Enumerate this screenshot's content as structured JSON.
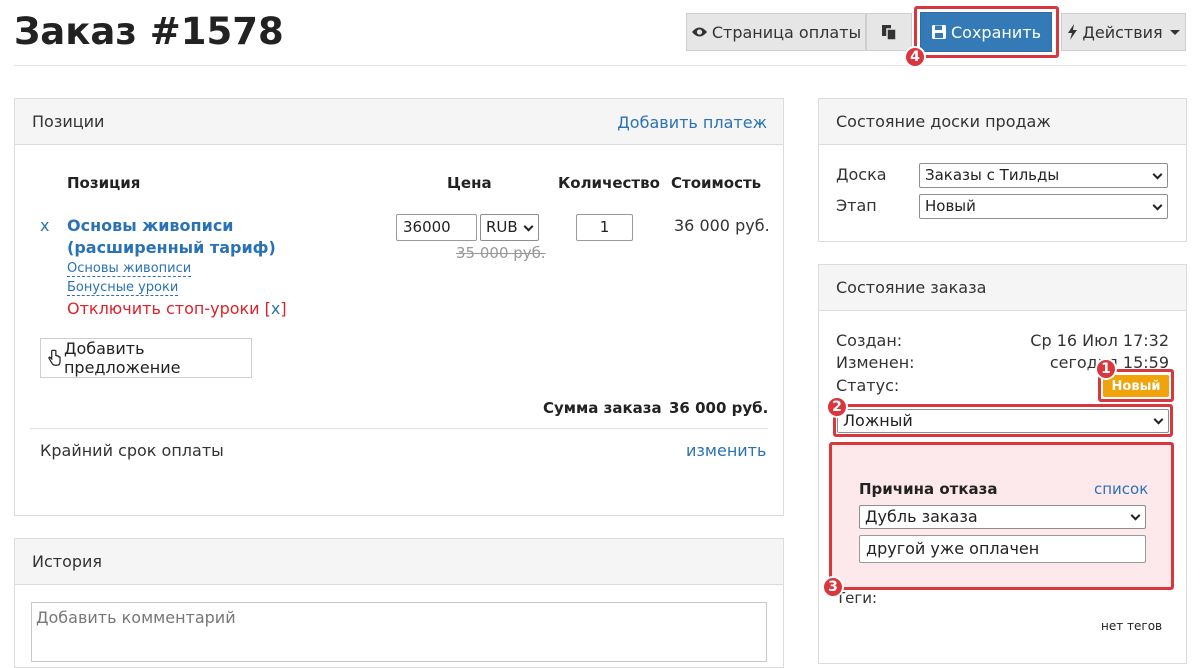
{
  "header": {
    "title": "Заказ #1578",
    "payment_page_label": "Страница оплаты",
    "save_label": "Сохранить",
    "actions_label": "Действия"
  },
  "positions": {
    "title": "Позиции",
    "add_payment": "Добавить платеж",
    "columns": {
      "item": "Позиция",
      "price": "Цена",
      "quantity": "Количество",
      "cost": "Стоимость"
    },
    "row": {
      "remove": "x",
      "name": "Основы живописи (расширенный тариф)",
      "sub_items": [
        "Основы живописи",
        "Бонусные уроки"
      ],
      "disable_stop": "Отключить стоп-уроки",
      "disable_stop_x": "x",
      "price": "36000",
      "currency": "RUB",
      "old_price": "35 000 руб.",
      "quantity": "1",
      "cost": "36 000 руб."
    },
    "add_offer": "Добавить предложение",
    "total_label": "Сумма заказа",
    "total_value": "36 000 руб.",
    "deadline_label": "Крайний срок оплаты",
    "deadline_change": "изменить"
  },
  "history": {
    "title": "История",
    "comment_placeholder": "Добавить комментарий"
  },
  "board": {
    "title": "Состояние доски продаж",
    "board_label": "Доска",
    "board_value": "Заказы с Тильды",
    "stage_label": "Этап",
    "stage_value": "Новый"
  },
  "order_state": {
    "title": "Состояние заказа",
    "created_label": "Создан:",
    "created_value": "Ср 16 Июл 17:32",
    "changed_label": "Изменен:",
    "changed_value": "сегодня 15:59",
    "status_label": "Статус:",
    "status_badge": "Новый",
    "status_select": "Ложный",
    "reason_title": "Причина отказа",
    "reason_list": "список",
    "reason_select": "Дубль заказа",
    "reason_comment": "другой уже оплачен",
    "tags_label": "Теги:",
    "no_tags": "нет тегов"
  },
  "markers": [
    "1",
    "2",
    "3",
    "4"
  ],
  "colors": {
    "accent": "#337ab7",
    "link": "#2a72b5",
    "danger": "#d9363e",
    "badge": "#f0a30a",
    "reason_bg": "#fde8ec"
  }
}
